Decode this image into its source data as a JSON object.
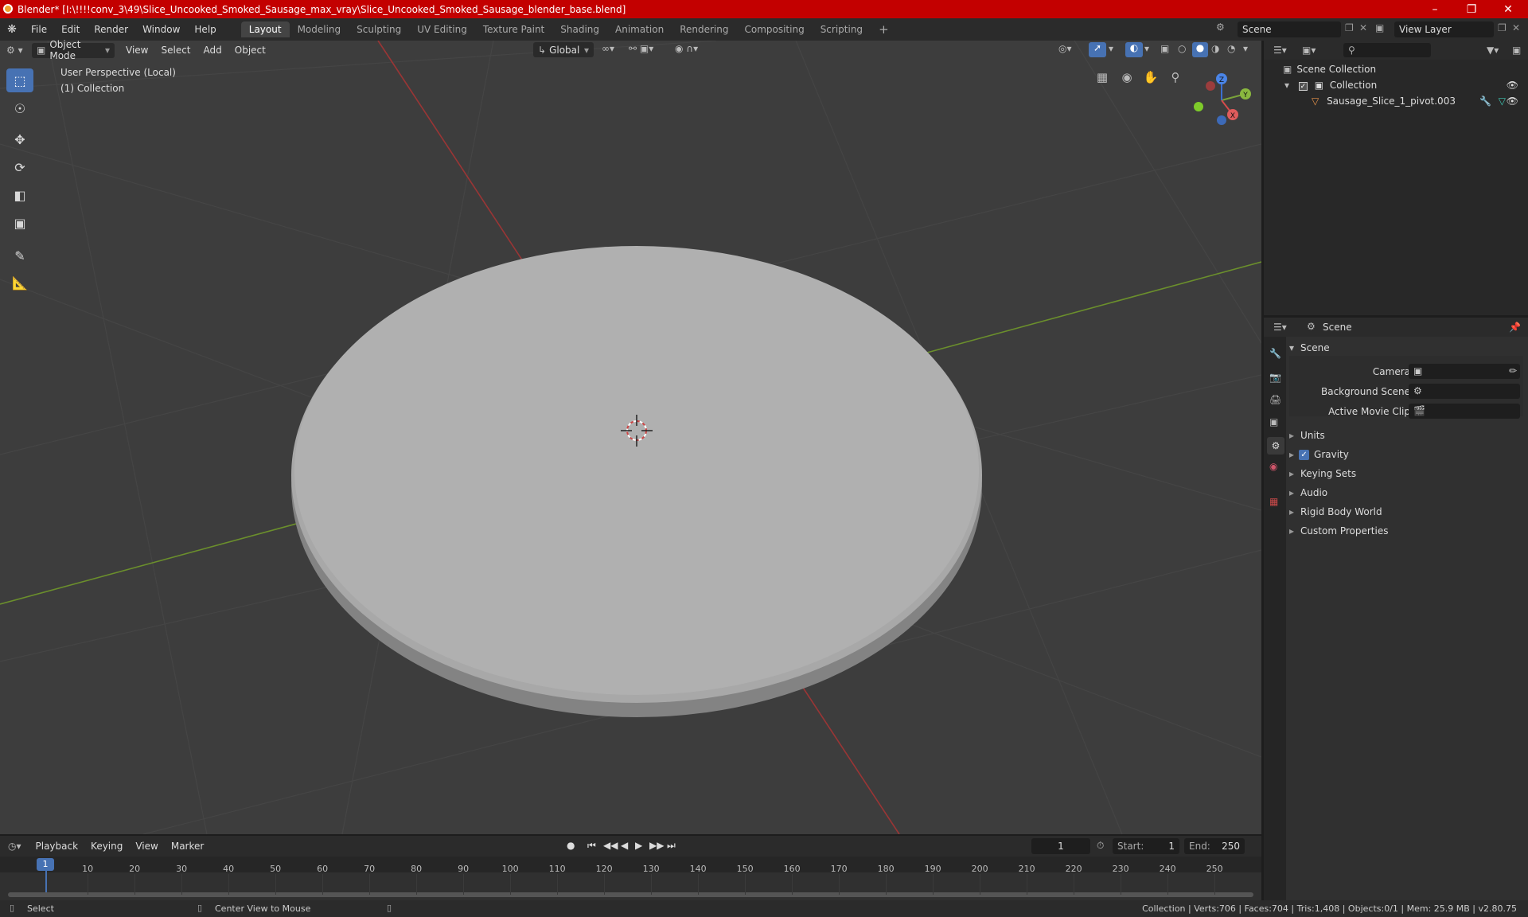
{
  "window": {
    "title": "Blender* [I:\\!!!!conv_3\\49\\Slice_Uncooked_Smoked_Sausage_max_vray\\Slice_Uncooked_Smoked_Sausage_blender_base.blend]"
  },
  "menus": [
    "File",
    "Edit",
    "Render",
    "Window",
    "Help"
  ],
  "workspaces": [
    "Layout",
    "Modeling",
    "Sculpting",
    "UV Editing",
    "Texture Paint",
    "Shading",
    "Animation",
    "Rendering",
    "Compositing",
    "Scripting"
  ],
  "scene_name": "Scene",
  "view_layer": "View Layer",
  "viewport": {
    "mode": "Object Mode",
    "menus": [
      "View",
      "Select",
      "Add",
      "Object"
    ],
    "orientation": "Global",
    "overlay_line1": "User Perspective (Local)",
    "overlay_line2": "(1) Collection",
    "axes": {
      "x": "X",
      "y": "Y",
      "z": "Z"
    }
  },
  "outliner": {
    "root": "Scene Collection",
    "collection": "Collection",
    "object": "Sausage_Slice_1_pivot.003"
  },
  "properties": {
    "context": "Scene",
    "panel": "Scene",
    "fields": [
      {
        "label": "Camera"
      },
      {
        "label": "Background Scene"
      },
      {
        "label": "Active Movie Clip"
      }
    ],
    "subpanels": [
      "Units",
      "Gravity",
      "Keying Sets",
      "Audio",
      "Rigid Body World",
      "Custom Properties"
    ],
    "gravity_checked": true
  },
  "timeline": {
    "menus": [
      "Playback",
      "Keying",
      "View",
      "Marker"
    ],
    "current_frame": "1",
    "start_label": "Start:",
    "start": "1",
    "end_label": "End:",
    "end": "250",
    "ticks": [
      "10",
      "20",
      "30",
      "40",
      "50",
      "60",
      "70",
      "80",
      "90",
      "100",
      "110",
      "120",
      "130",
      "140",
      "150",
      "160",
      "170",
      "180",
      "190",
      "200",
      "210",
      "220",
      "230",
      "240",
      "250"
    ],
    "playhead_label": "1"
  },
  "status": {
    "left1": "Select",
    "left2": "Center View to Mouse",
    "right": "Collection | Verts:706 | Faces:704 | Tris:1,408 | Objects:0/1 | Mem: 25.9 MB | v2.80.75"
  },
  "colors": {
    "titlebar": "#c30000",
    "accent": "#4772b3",
    "x_axis": "#b33a3a",
    "y_axis": "#6e9a2b"
  }
}
